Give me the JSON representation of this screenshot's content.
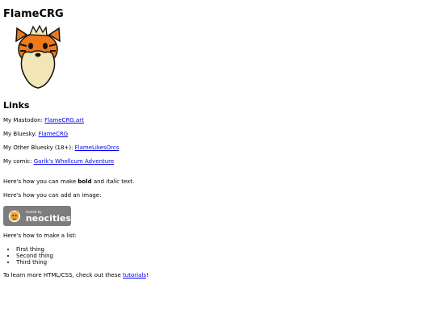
{
  "title": "FlameCRG",
  "links_heading": "Links",
  "links": [
    {
      "prefix": "My Mastodon: ",
      "link_text": "FlameCRG.art"
    },
    {
      "prefix": "My Bluesky: ",
      "link_text": "FlameCRG"
    },
    {
      "prefix": "My Other Bluesky (18+): ",
      "link_text": "FlameLikesOrcs"
    },
    {
      "prefix": "My comic: ",
      "link_text": "Garik's Whellcum Adventure"
    }
  ],
  "format_text": {
    "pre": "Here's how you can make ",
    "bold": "bold",
    "mid": " and ",
    "italic": "italic",
    "post": " text."
  },
  "image_text": "Here's how you can add an image:",
  "badge": {
    "small_text": "hosted by",
    "big_text": "neocities"
  },
  "list_intro": "Here's how to make a list:",
  "list_items": [
    "First thing",
    "Second thing",
    "Third thing"
  ],
  "learn": {
    "pre": "To learn more HTML/CSS, check out these ",
    "link": "tutorials",
    "post": "!"
  }
}
